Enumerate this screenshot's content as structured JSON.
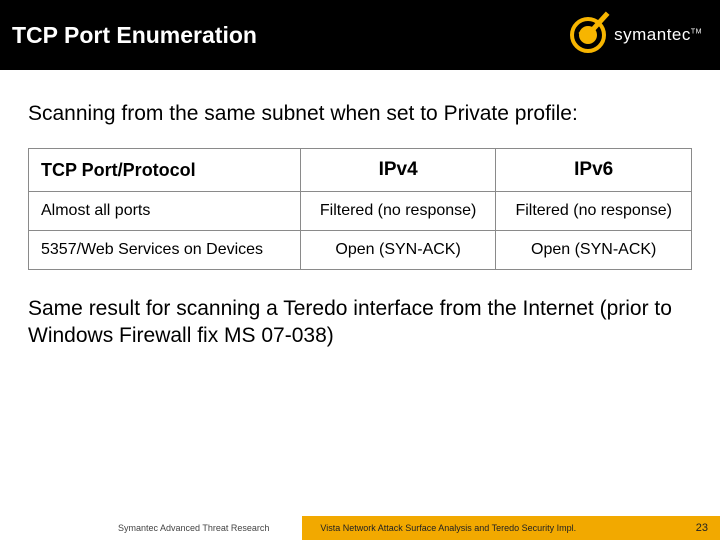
{
  "header": {
    "title": "TCP Port Enumeration",
    "brand": "symantec",
    "tm": "TM"
  },
  "lead": "Scanning from the same subnet when set to Private profile:",
  "table": {
    "headers": {
      "protocol": "TCP Port/Protocol",
      "ipv4": "IPv4",
      "ipv6": "IPv6"
    },
    "rows": [
      {
        "protocol": "Almost all ports",
        "ipv4": "Filtered (no response)",
        "ipv6": "Filtered (no response)"
      },
      {
        "protocol": "5357/Web Services on Devices",
        "ipv4": "Open (SYN-ACK)",
        "ipv6": "Open (SYN-ACK)"
      }
    ]
  },
  "note": "Same result for scanning a Teredo interface from the Internet (prior to Windows Firewall fix MS 07-038)",
  "footer": {
    "left": "Symantec Advanced Threat Research",
    "right": "Vista Network Attack Surface Analysis and Teredo Security Impl.",
    "page": "23"
  }
}
